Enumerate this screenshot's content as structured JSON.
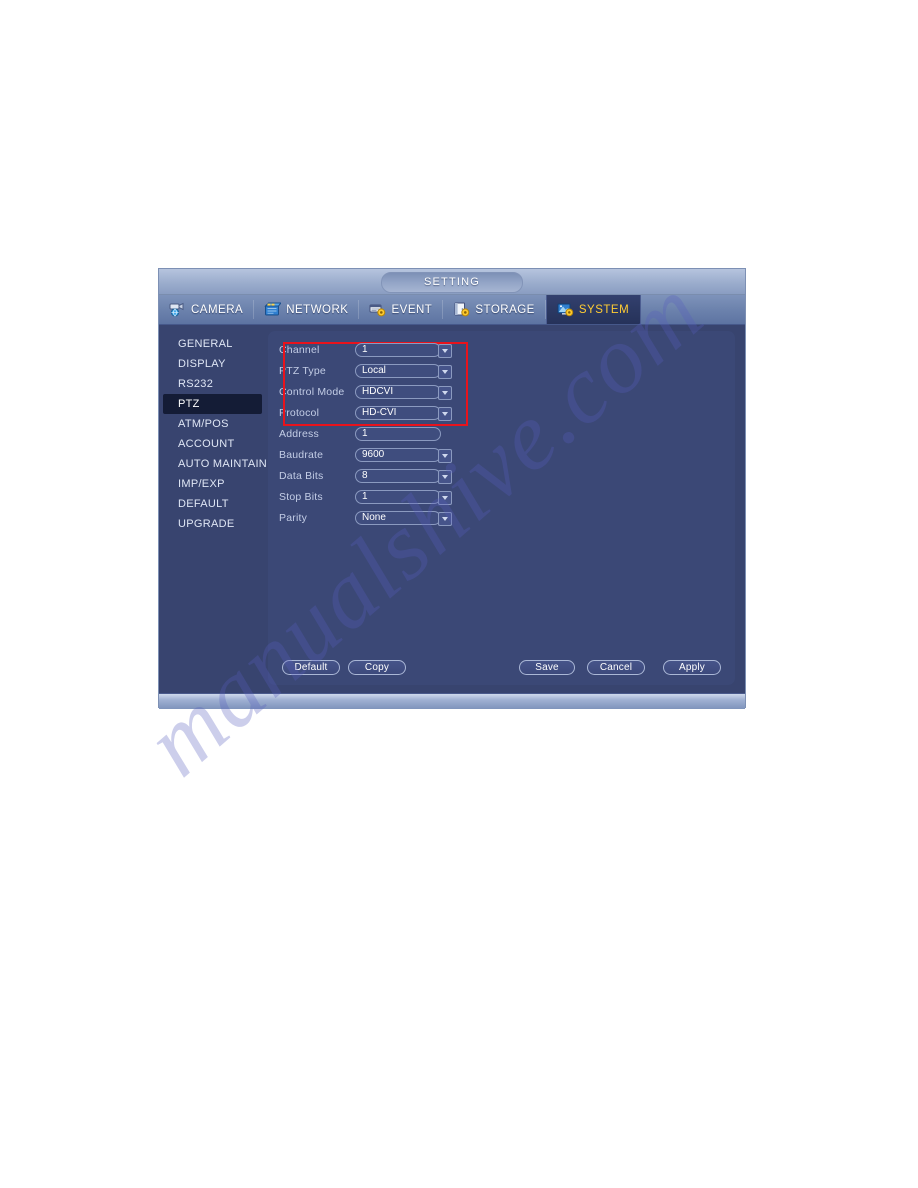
{
  "dialog": {
    "title": "SETTING"
  },
  "tabs": [
    {
      "label": "CAMERA",
      "icon": "camera-globe-icon",
      "active": false
    },
    {
      "label": "NETWORK",
      "icon": "network-icon",
      "active": false
    },
    {
      "label": "EVENT",
      "icon": "event-gear-icon",
      "active": false
    },
    {
      "label": "STORAGE",
      "icon": "storage-gear-icon",
      "active": false
    },
    {
      "label": "SYSTEM",
      "icon": "system-gear-icon",
      "active": true
    }
  ],
  "sidebar": {
    "items": [
      {
        "label": "GENERAL",
        "selected": false
      },
      {
        "label": "DISPLAY",
        "selected": false
      },
      {
        "label": "RS232",
        "selected": false
      },
      {
        "label": "PTZ",
        "selected": true
      },
      {
        "label": "ATM/POS",
        "selected": false
      },
      {
        "label": "ACCOUNT",
        "selected": false
      },
      {
        "label": "AUTO MAINTAIN",
        "selected": false
      },
      {
        "label": "IMP/EXP",
        "selected": false
      },
      {
        "label": "DEFAULT",
        "selected": false
      },
      {
        "label": "UPGRADE",
        "selected": false
      }
    ]
  },
  "form": {
    "fields": [
      {
        "label": "Channel",
        "value": "1",
        "type": "dropdown",
        "highlighted": true
      },
      {
        "label": "PTZ Type",
        "value": "Local",
        "type": "dropdown",
        "highlighted": true
      },
      {
        "label": "Control Mode",
        "value": "HDCVI",
        "type": "dropdown",
        "highlighted": true
      },
      {
        "label": "Protocol",
        "value": "HD-CVI",
        "type": "dropdown",
        "highlighted": true
      },
      {
        "label": "Address",
        "value": "1",
        "type": "text",
        "highlighted": false
      },
      {
        "label": "Baudrate",
        "value": "9600",
        "type": "dropdown",
        "highlighted": false
      },
      {
        "label": "Data Bits",
        "value": "8",
        "type": "dropdown",
        "highlighted": false
      },
      {
        "label": "Stop Bits",
        "value": "1",
        "type": "dropdown",
        "highlighted": false
      },
      {
        "label": "Parity",
        "value": "None",
        "type": "dropdown",
        "highlighted": false
      }
    ]
  },
  "buttons": {
    "default_label": "Default",
    "copy_label": "Copy",
    "save_label": "Save",
    "cancel_label": "Cancel",
    "apply_label": "Apply"
  },
  "watermark": {
    "text": "manualshive.com"
  },
  "colors": {
    "highlight_box": "#e8131c",
    "active_tab_text": "#ffcc33",
    "panel_bg": "#3b4876",
    "dialog_bg": "#38446f"
  }
}
